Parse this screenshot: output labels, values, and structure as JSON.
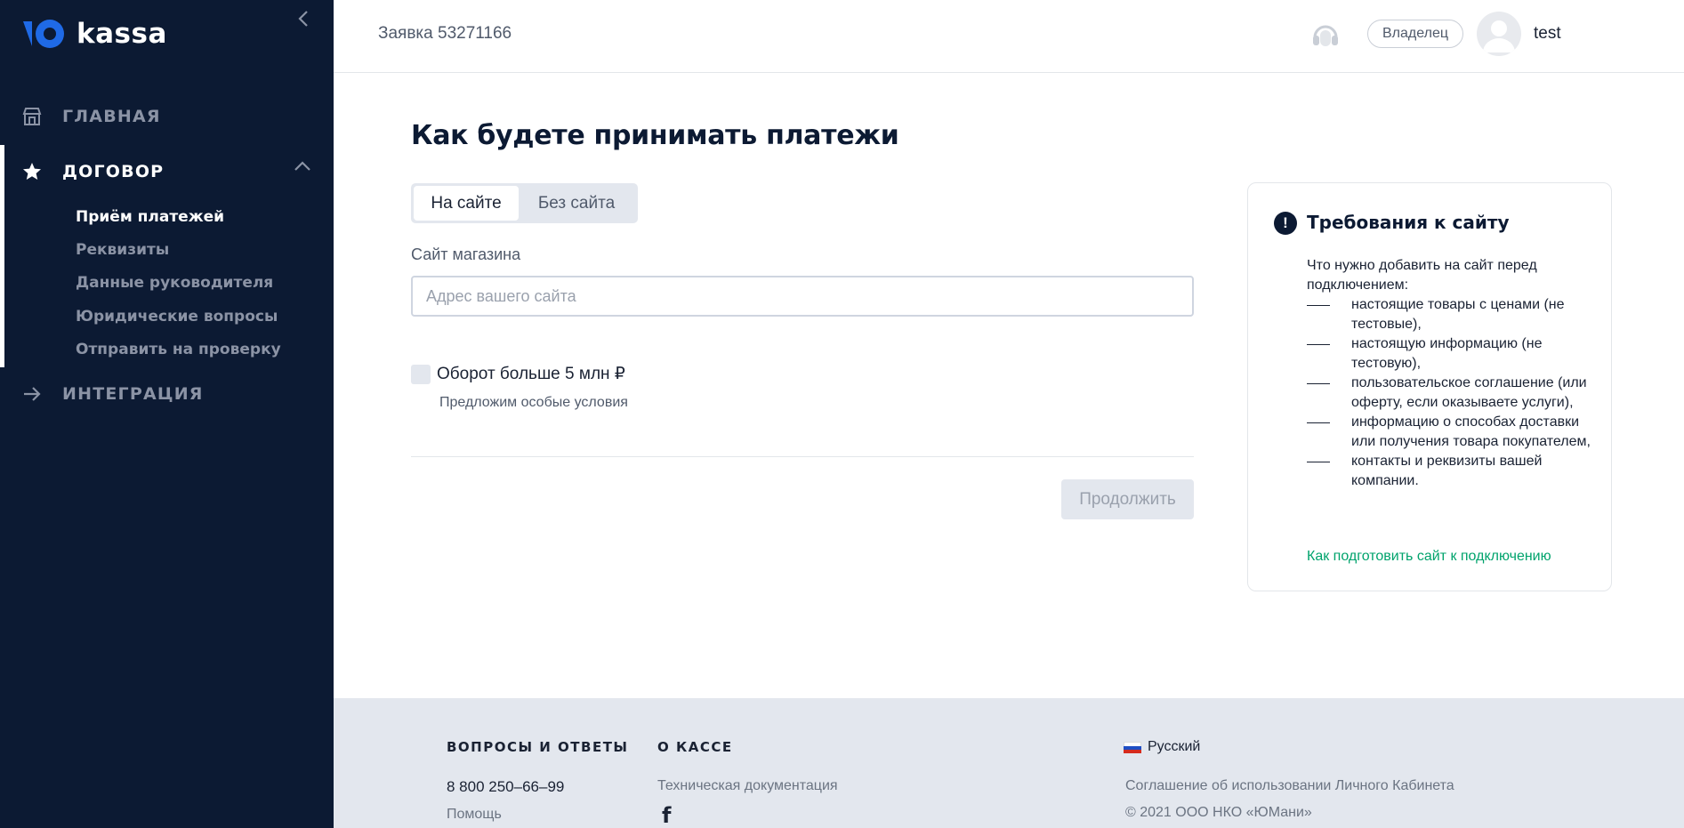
{
  "sidebar": {
    "logo_text": "kassa",
    "nav": {
      "home": "ГЛАВНАЯ",
      "contract": "ДОГОВОР",
      "integration": "ИНТЕГРАЦИЯ"
    },
    "sub_items": [
      "Приём платежей",
      "Реквизиты",
      "Данные руководителя",
      "Юридические вопросы",
      "Отправить на проверку"
    ]
  },
  "header": {
    "order_title": "Заявка 53271166",
    "role": "Владелец",
    "username": "test"
  },
  "main": {
    "title": "Как будете принимать платежи",
    "tabs": [
      "На сайте",
      "Без сайта"
    ],
    "selected_tab": "На сайте",
    "site_label": "Сайт магазина",
    "site_placeholder": "Адрес вашего сайта",
    "site_value": "",
    "turnover_label": "Оборот больше 5 млн ₽",
    "turnover_checked": false,
    "turnover_hint": "Предложим особые условия",
    "continue_label": "Продолжить"
  },
  "requirements": {
    "title": "Требования к сайту",
    "intro": "Что нужно добавить на сайт перед подключением:",
    "items": [
      "настоящие товары с ценами (не тестовые),",
      "настоящую информацию (не тестовую),",
      "пользовательское соглашение (или оферту, если оказываете услуги),",
      "информацию о способах доставки или получения товара покупателем,",
      "контакты и реквизиты вашей компании."
    ],
    "link": "Как подготовить сайт к подключению"
  },
  "footer": {
    "faq_heading": "ВОПРОСЫ И ОТВЕТЫ",
    "phone": "8 800 250–66–99",
    "help": "Помощь",
    "about_heading": "О КАССЕ",
    "tech_docs": "Техническая документация",
    "language": "Русский",
    "agreement": "Соглашение об использовании Личного Кабинета",
    "copyright": "© 2021  ООО НКО «ЮМани»"
  },
  "colors": {
    "sidebar_bg": "#0c1a33",
    "logo_blue": "#1f6ae6",
    "link_green": "#00a36c",
    "footer_bg": "#e3e7ee"
  }
}
